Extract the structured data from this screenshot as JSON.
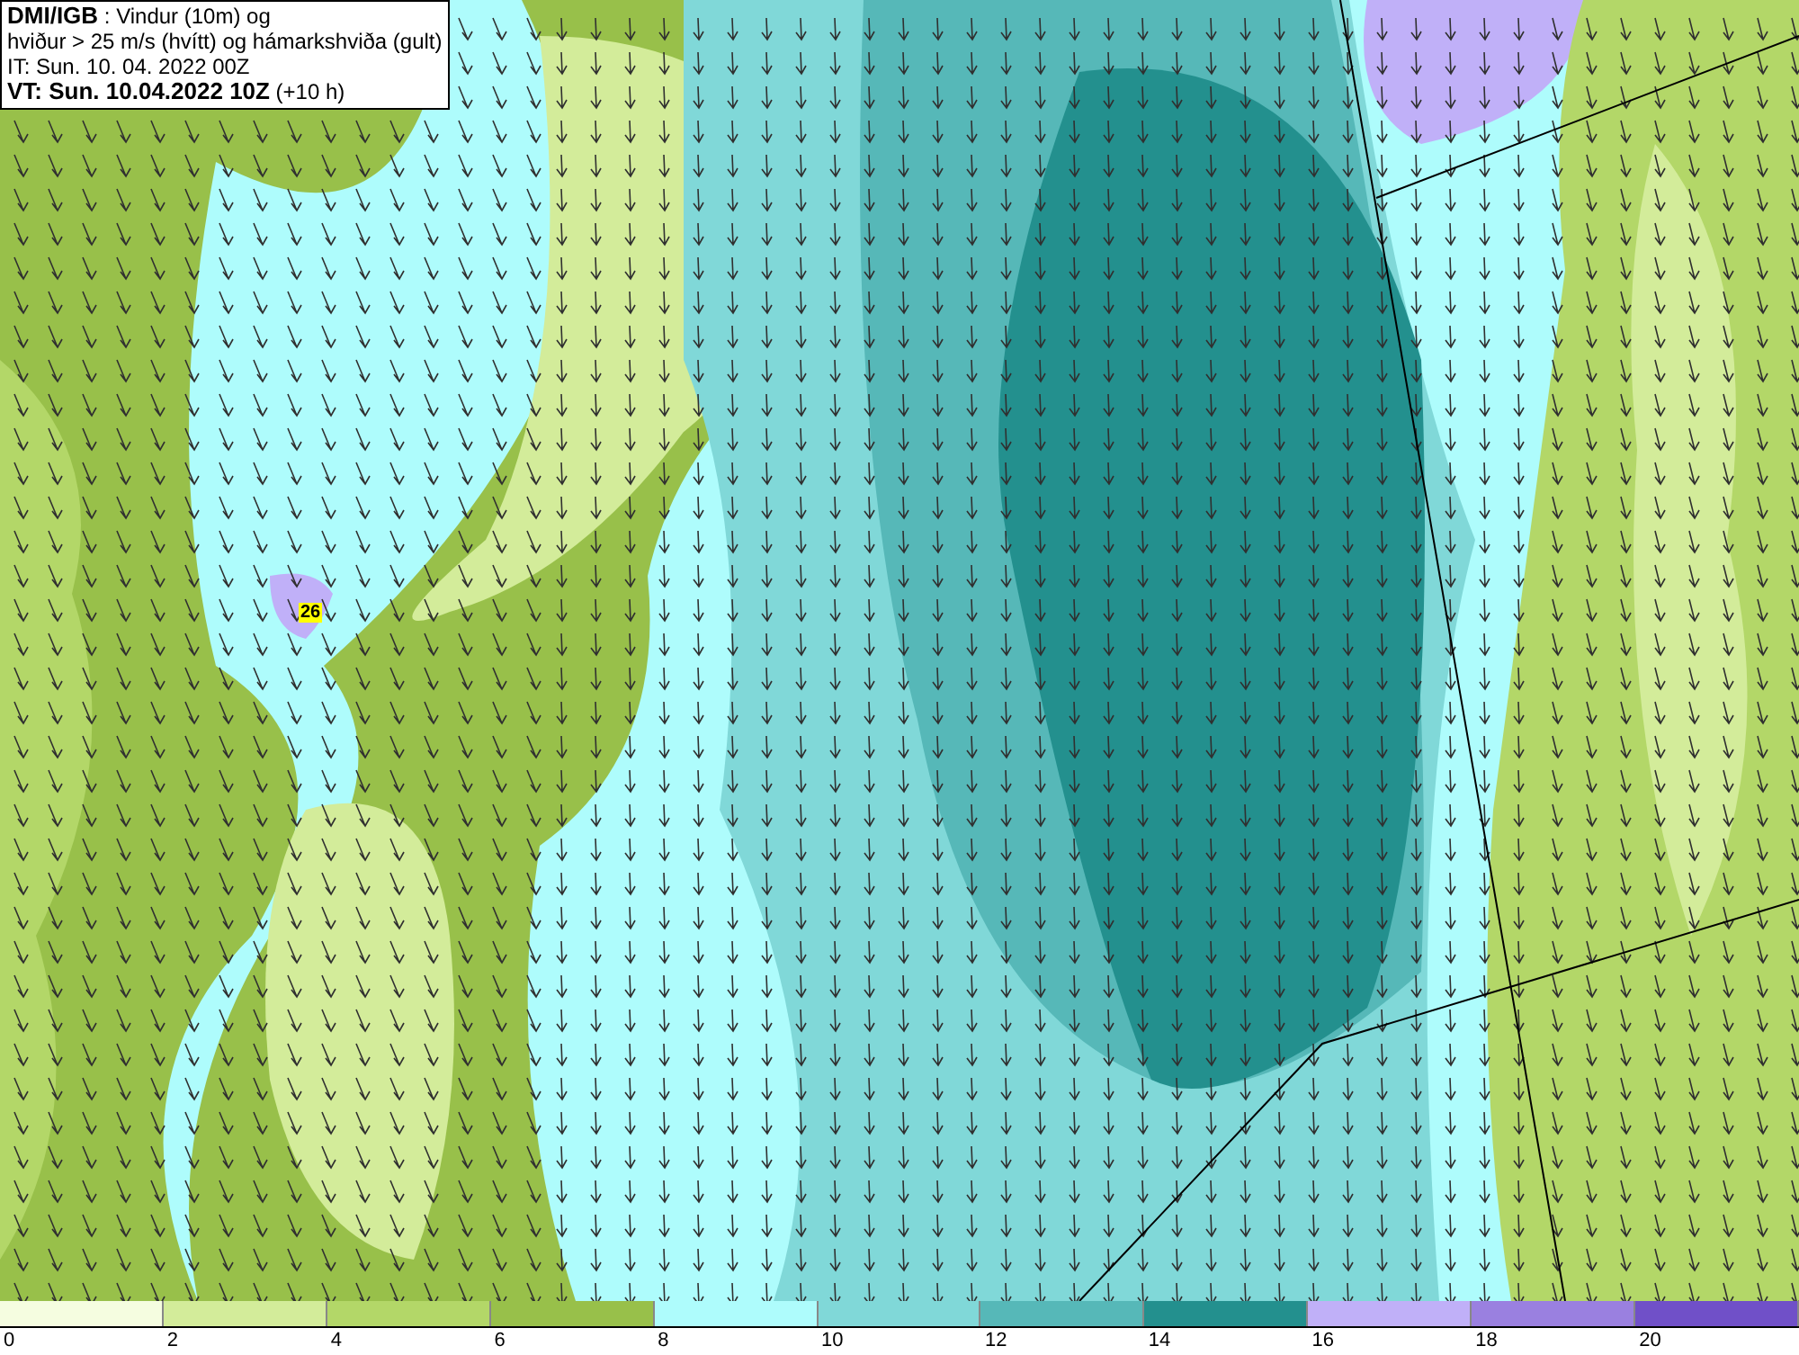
{
  "legend": {
    "lines": [
      "**DMI/IGB** : Vindur (10m) og",
      "hviður > 25 m/s (hvítt) og hámarkshviða (gult)",
      "IT: Sun. 10. 04. 2022 00Z",
      "**VT: Sun. 10.04.2022 10Z** (+10 h)"
    ]
  },
  "map": {
    "gust_marker": "26"
  },
  "colorbar": {
    "swatches": [
      {
        "color": "#f5fde0"
      },
      {
        "color": "#d3ec9a"
      },
      {
        "color": "#b3d768"
      },
      {
        "color": "#98c04a"
      },
      {
        "color": "#aefcfc"
      },
      {
        "color": "#80d8d8"
      },
      {
        "color": "#56b8b8"
      },
      {
        "color": "#23908e"
      },
      {
        "color": "#c0b0f8"
      },
      {
        "color": "#9a80e0"
      },
      {
        "color": "#7050c8"
      }
    ],
    "ticks": [
      "0",
      "2",
      "4",
      "6",
      "8",
      "10",
      "12",
      "14",
      "16",
      "18",
      "20"
    ]
  }
}
